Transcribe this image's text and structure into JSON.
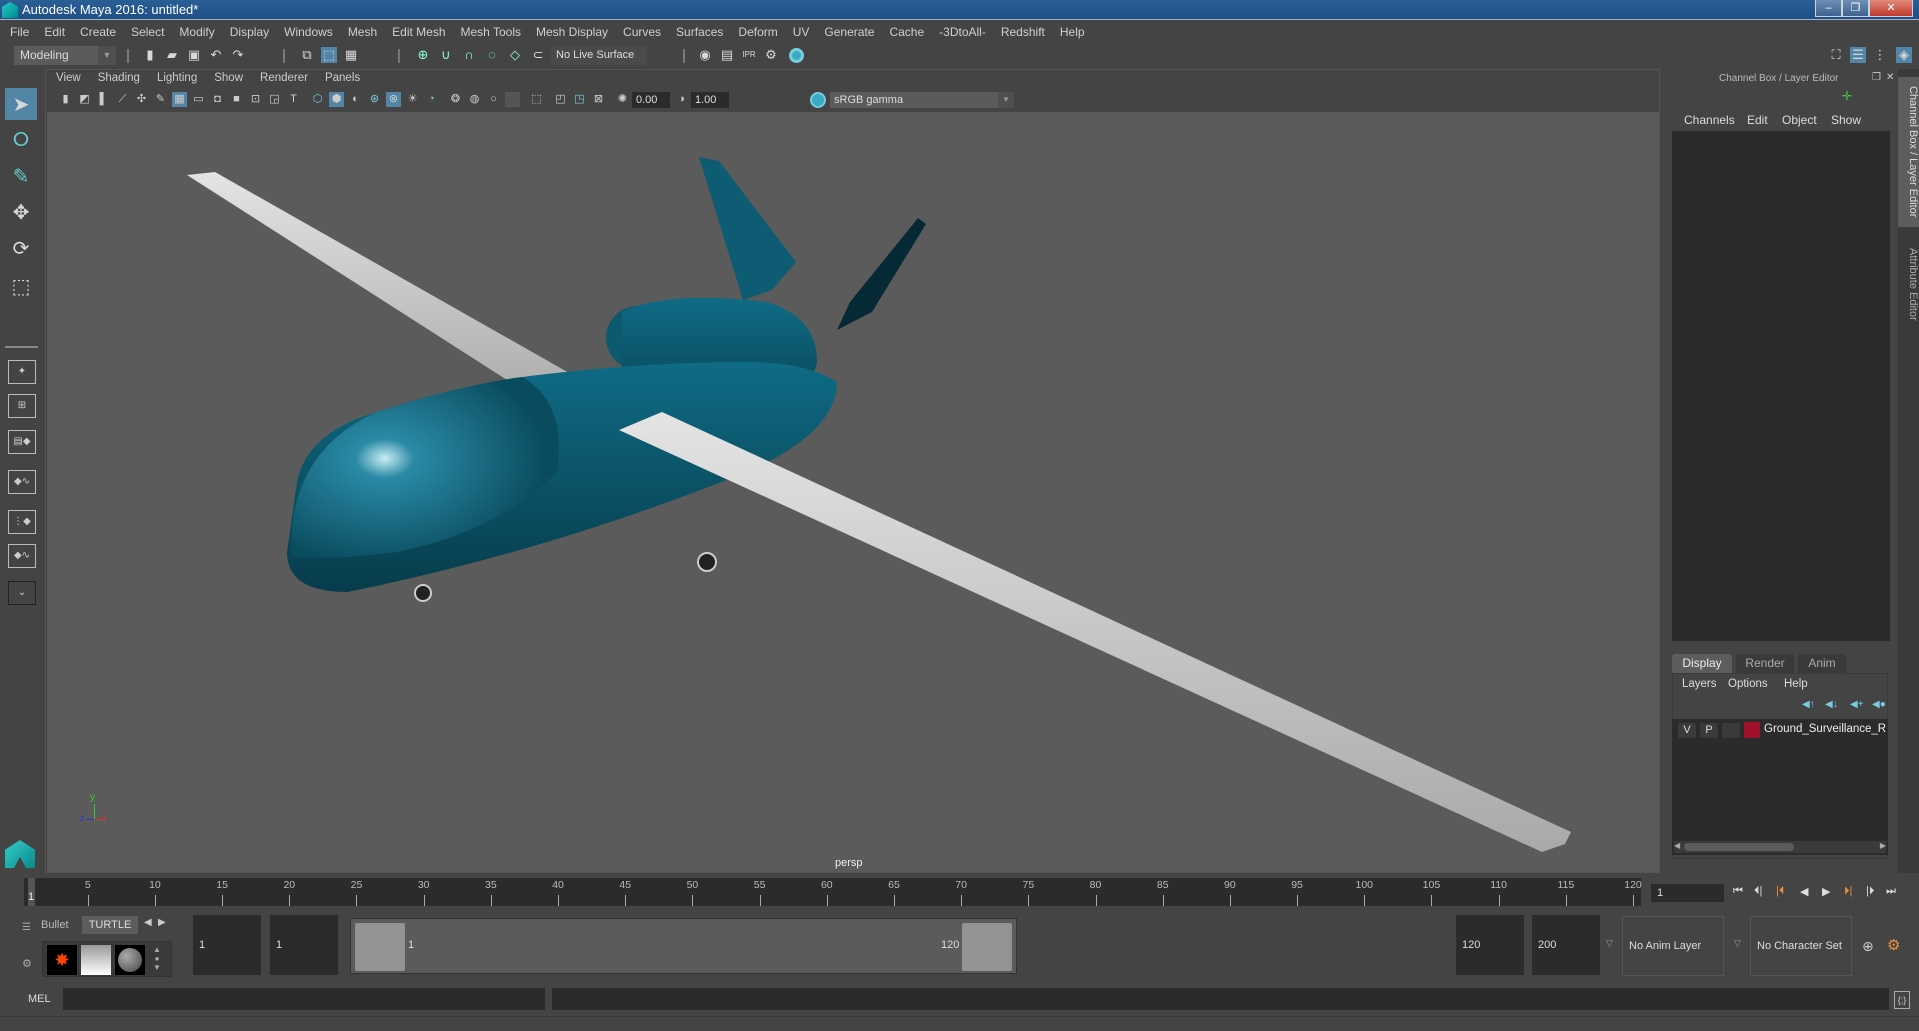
{
  "window": {
    "title": "Autodesk Maya 2016: untitled*",
    "controls": {
      "minimize": "–",
      "restore": "❐",
      "close": "✕"
    }
  },
  "menubar": {
    "items": [
      "File",
      "Edit",
      "Create",
      "Select",
      "Modify",
      "Display",
      "Windows",
      "Mesh",
      "Edit Mesh",
      "Mesh Tools",
      "Mesh Display",
      "Curves",
      "Surfaces",
      "Deform",
      "UV",
      "Generate",
      "Cache",
      "-3DtoAll-",
      "Redshift",
      "Help"
    ]
  },
  "statusline": {
    "mode": "Modeling",
    "live_surface": "No Live Surface",
    "icons": [
      "new-scene",
      "open-scene",
      "save-scene",
      "undo",
      "redo",
      "select-by-hierarchy",
      "select-by-object",
      "select-by-component",
      "snap-to-grid",
      "snap-to-curve",
      "snap-to-point",
      "snap-to-projected-center",
      "snap-to-view-plane",
      "make-live",
      "render-current-frame",
      "render-sequence",
      "ipr-render",
      "render-settings",
      "hypershade"
    ]
  },
  "toolbox": {
    "tools": [
      "select-tool",
      "lasso-tool",
      "paint-select-tool",
      "move-tool",
      "rotate-tool",
      "scale-tool"
    ],
    "layouts": [
      "single-perspective",
      "four-view",
      "persp-outliner",
      "persp-graph",
      "hypershade-persp",
      "persp-graph-hypergraph"
    ],
    "more_label": "⌄"
  },
  "viewport": {
    "menu": [
      "View",
      "Shading",
      "Lighting",
      "Show",
      "Renderer",
      "Panels"
    ],
    "exposure": "0.00",
    "gamma": "1.00",
    "color_space": "sRGB gamma",
    "camera_label": "persp",
    "axis": {
      "x": "x",
      "y": "y",
      "z": "z"
    },
    "model_colors": {
      "fuselage": "#0f5a70",
      "wing": "#c8c8c8",
      "background": "#5b5b5b"
    }
  },
  "channel_box": {
    "title": "Channel Box / Layer Editor",
    "menu": [
      "Channels",
      "Edit",
      "Object",
      "Show"
    ]
  },
  "layer_editor": {
    "tabs": [
      "Display",
      "Render",
      "Anim"
    ],
    "active_tab": "Display",
    "menu": [
      "Layers",
      "Options",
      "Help"
    ],
    "layers": [
      {
        "visible": "V",
        "playback": "P",
        "type": "",
        "color": "#a0102a",
        "name": "Ground_Surveillance_Re"
      }
    ]
  },
  "side_tabs": [
    "Channel Box / Layer Editor",
    "Attribute Editor"
  ],
  "timeline": {
    "start_label": "1",
    "ticks": [
      5,
      10,
      15,
      20,
      25,
      30,
      35,
      40,
      45,
      50,
      55,
      60,
      65,
      70,
      75,
      80,
      85,
      90,
      95,
      100,
      105,
      110,
      115,
      120
    ],
    "current_frame": "1",
    "playback_buttons": [
      "go-to-start",
      "step-back-key",
      "step-back-frame",
      "play-backward",
      "play-forward",
      "step-forward-frame",
      "step-forward-key",
      "go-to-end"
    ]
  },
  "range_slider": {
    "shelf_tabs": [
      "Bullet",
      "TURTLE"
    ],
    "animation_start": "1",
    "playback_start": "1",
    "range_start_label": "1",
    "range_end_label": "120",
    "playback_end": "120",
    "animation_end": "200",
    "anim_layer": "No Anim Layer",
    "character_set": "No Character Set"
  },
  "command_line": {
    "label": "MEL",
    "value": ""
  }
}
